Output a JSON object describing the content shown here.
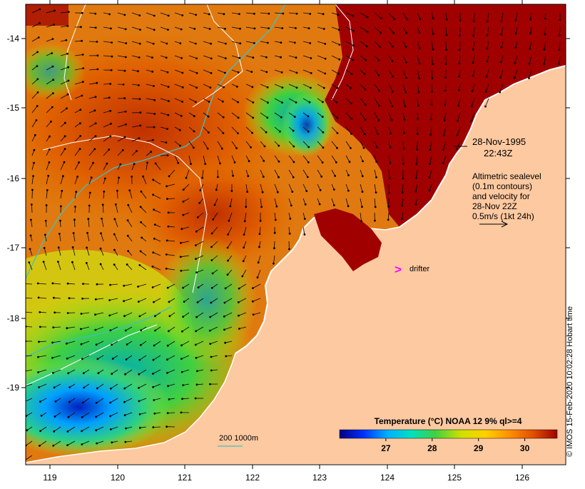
{
  "map": {
    "lat_labels": [
      "-14",
      "-15",
      "-16",
      "-17",
      "-18",
      "-19"
    ],
    "lon_labels": [
      "119",
      "120",
      "121",
      "122",
      "123",
      "124",
      "125",
      "126"
    ],
    "lon_range": [
      118.65,
      126.65
    ],
    "lat_range": [
      -20.1,
      -13.6
    ],
    "colors": {
      "land": "#fdc9a0",
      "warm": "#a00000",
      "coast": "#ffffff",
      "contour_200m": "#40c0c0",
      "sealevel_contour": "#ffffff",
      "drifter": "#ff00ff",
      "arrow": "#000000"
    }
  },
  "annotations": {
    "date_line1": "28-Nov-1995",
    "date_line2": "22:43Z",
    "altimetry_line1": "Altimetric sealevel",
    "altimetry_line2": "(0.1m contours)",
    "altimetry_line3": "and velocity for",
    "altimetry_line4": "28-Nov 22Z",
    "altimetry_line5": "0.5m/s (1kt 24h)",
    "drifter_symbol": ">",
    "drifter_label": "drifter",
    "bathymetry_label": "200  1000m"
  },
  "colorbar": {
    "title": "Temperature (°C) NOAA 12 9% ql>=4",
    "ticks": [
      "27",
      "28",
      "29",
      "30"
    ],
    "tick_values": [
      27,
      28,
      29,
      30
    ],
    "range": [
      26.0,
      30.7
    ],
    "stops": [
      "#000080",
      "#0030ff",
      "#00b0ff",
      "#00e0c0",
      "#40d040",
      "#d0e000",
      "#ffd000",
      "#ff9000",
      "#e05000",
      "#a00000"
    ]
  },
  "credit": "© IMOS 15-Feb-2020 10:02:28 Hobart time"
}
